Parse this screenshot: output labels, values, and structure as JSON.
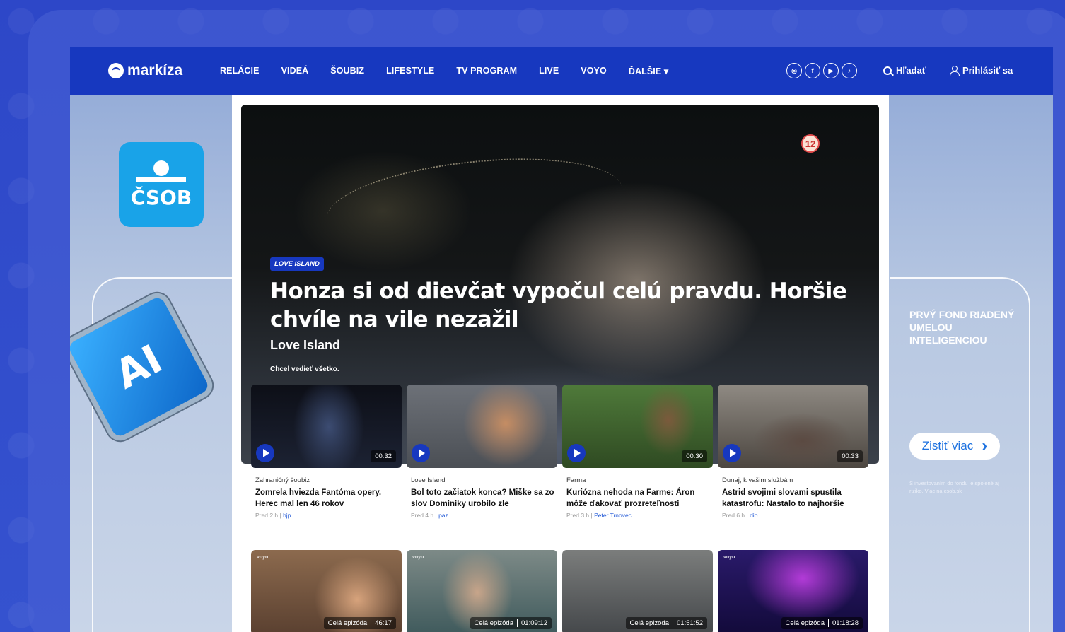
{
  "nav": {
    "logo": "markíza",
    "menu": [
      "RELÁCIE",
      "VIDEÁ",
      "ŠOUBIZ",
      "LIFESTYLE",
      "TV PROGRAM",
      "LIVE",
      "VOYO",
      "ĎALŠIE ▾"
    ],
    "social": [
      {
        "icon": "instagram-icon",
        "glyph": "◎"
      },
      {
        "icon": "facebook-icon",
        "glyph": "f"
      },
      {
        "icon": "youtube-icon",
        "glyph": "▶"
      },
      {
        "icon": "tiktok-icon",
        "glyph": "♪"
      }
    ],
    "search_label": "Hľadať",
    "login_label": "Prihlásiť sa"
  },
  "ad_left": {
    "brand": "ČSOB",
    "chip_text": "AI"
  },
  "ad_right": {
    "title": "PRVÝ FOND RIADENÝ UMELOU INTELIGENCIOU",
    "button_label": "Zistiť viac",
    "button_arrow": "›",
    "note": "S investovaním do fondu je spojené aj riziko. Viac na csob.sk"
  },
  "hero": {
    "tag": "LOVE ISLAND",
    "rating": "12",
    "headline": "Honza si od dievčat vypočul celú pravdu. Horšie chvíle na vile nezažil",
    "show": "Love Island",
    "subtitle": "Chcel vedieť všetko."
  },
  "cards": [
    {
      "category": "Zahraničný šoubiz",
      "title": "Zomrela hviezda Fantóma opery. Herec mal len 46 rokov",
      "time": "Pred 2 h",
      "author": "hjp",
      "duration": "00:32"
    },
    {
      "category": "Love Island",
      "title": "Bol toto začiatok konca? Miške sa zo slov Dominiky urobilo zle",
      "time": "Pred 4 h",
      "author": "paz",
      "duration": ""
    },
    {
      "category": "Farma",
      "title": "Kuriózna nehoda na Farme: Áron môže ďakovať prozreteľnosti",
      "time": "Pred 3 h",
      "author": "Peter Trnovec",
      "duration": "00:30"
    },
    {
      "category": "Dunaj, k vašim službám",
      "title": "Astrid svojimi slovami spustila katastrofu: Nastalo to najhoršie",
      "time": "Pred 6 h",
      "author": "dio",
      "duration": "00:33"
    }
  ],
  "episodes": [
    {
      "badge": "voyo",
      "label": "Celá epizóda",
      "duration": "46:17"
    },
    {
      "badge": "voyo",
      "label": "Celá epizóda",
      "duration": "01:09:12"
    },
    {
      "badge": "",
      "label": "Celá epizóda",
      "duration": "01:51:52"
    },
    {
      "badge": "voyo",
      "label": "Celá epizóda",
      "duration": "01:18:28"
    }
  ],
  "colors": {
    "brand_blue": "#1738bf",
    "author_link": "#1f57d6",
    "csob_blue": "#19a3e8"
  }
}
